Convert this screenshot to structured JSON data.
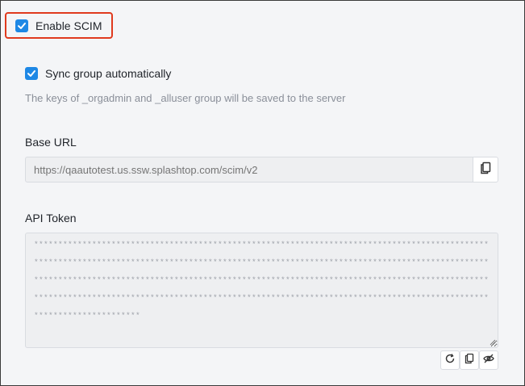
{
  "enable_scim": {
    "label": "Enable SCIM",
    "checked": true,
    "icon": "check-icon"
  },
  "sync_group": {
    "label": "Sync group automatically",
    "checked": true,
    "hint": "The keys of _orgadmin and _alluser group will be saved to the server"
  },
  "base_url": {
    "label": "Base URL",
    "placeholder": "https://qaautotest.us.ssw.splashtop.com/scim/v2",
    "copy_icon": "copy-icon"
  },
  "api_token": {
    "label": "API Token",
    "value": "**************************************************************************************************************************************************************************************************************************************************************************************************************************************************************************************************************",
    "actions": [
      {
        "name": "regenerate",
        "icon": "refresh-icon"
      },
      {
        "name": "copy",
        "icon": "copy-icon"
      },
      {
        "name": "toggle-visibility",
        "icon": "eye-off-icon"
      }
    ]
  },
  "colors": {
    "accent": "#1e88e5",
    "highlight": "#e03a1e"
  }
}
